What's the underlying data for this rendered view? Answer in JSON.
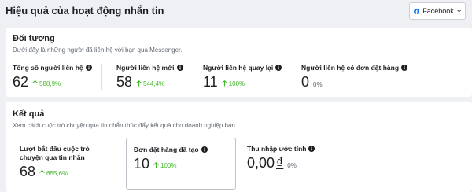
{
  "header": {
    "title": "Hiệu quả của hoạt động nhắn tin",
    "platform": "Facebook",
    "icons": {
      "platform": "facebook-icon",
      "dropdown": "chevron-down-icon",
      "info": "info-icon",
      "trend": "arrow-up-icon"
    }
  },
  "audience": {
    "title": "Đối tượng",
    "description": "Dưới đây là những người đã liên hệ với bạn qua Messenger.",
    "metrics": [
      {
        "label": "Tổng số người liên hệ",
        "value": "62",
        "change": "588,9%"
      },
      {
        "label": "Người liên hệ mới",
        "value": "58",
        "change": "544,4%"
      },
      {
        "label": "Người liên hệ quay lại",
        "value": "11",
        "change": "100%"
      },
      {
        "label": "Người liên hệ có đơn đặt hàng",
        "value": "0",
        "change": "0%"
      }
    ]
  },
  "results": {
    "title": "Kết quả",
    "description": "Xem cách cuộc trò chuyện qua tin nhắn thúc đẩy kết quả cho doanh nghiệp bạn.",
    "metrics": [
      {
        "label": "Lượt bắt đầu cuộc trò chuyện qua tin nhắn",
        "value": "68",
        "change": "655,6%"
      },
      {
        "label": "Đơn đặt hàng đã tạo",
        "value": "10",
        "change": "100%"
      },
      {
        "label": "Thu nhập ước tính",
        "value": "0,00",
        "currency": "₫",
        "change": "0%"
      }
    ]
  },
  "colors": {
    "positive": "#42b72a",
    "neutral": "#606770",
    "facebook": "#1877f2"
  }
}
